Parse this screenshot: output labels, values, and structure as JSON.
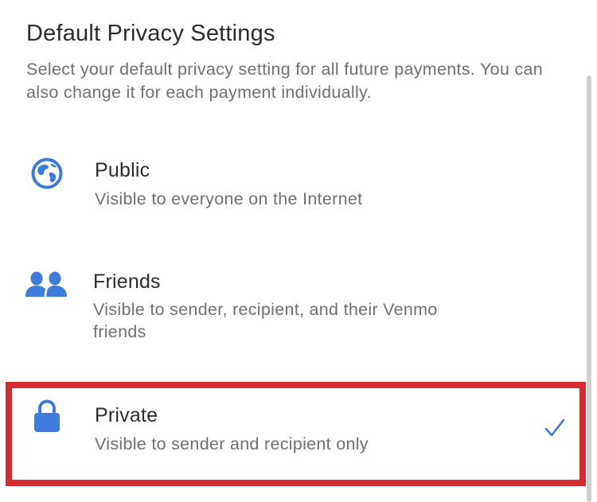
{
  "header": {
    "title": "Default Privacy Settings",
    "subtitle": "Select your default privacy setting for all future payments. You can also change it for each payment individually."
  },
  "options": [
    {
      "label": "Public",
      "description": "Visible to everyone on the Internet",
      "icon": "globe-icon",
      "selected": false
    },
    {
      "label": "Friends",
      "description": "Visible to sender, recipient, and their Venmo friends",
      "icon": "friends-icon",
      "selected": false
    },
    {
      "label": "Private",
      "description": "Visible to sender and recipient only",
      "icon": "lock-icon",
      "selected": true
    }
  ],
  "colors": {
    "accent": "#3d7bdd",
    "highlight": "#d42a30",
    "text_primary": "#2d2d2d",
    "text_secondary": "#707070"
  }
}
